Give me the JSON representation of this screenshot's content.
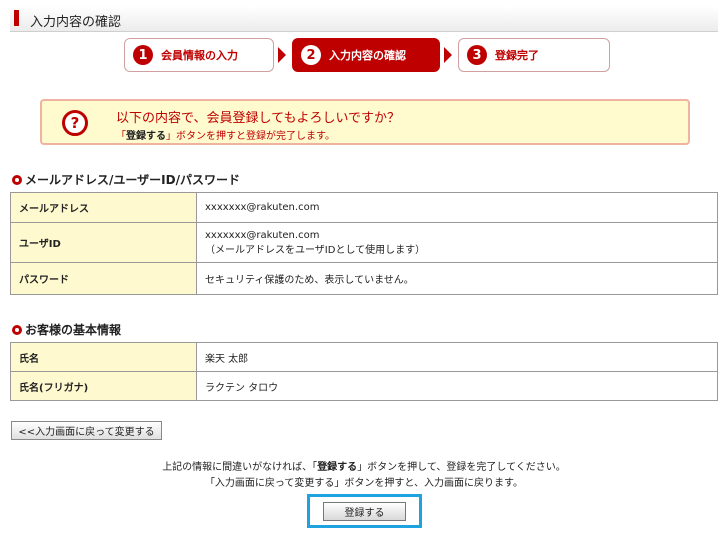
{
  "header": {
    "title": "入力内容の確認"
  },
  "steps": [
    {
      "num": "1",
      "label": "会員情報の入力"
    },
    {
      "num": "2",
      "label": "入力内容の確認"
    },
    {
      "num": "3",
      "label": "登録完了"
    }
  ],
  "confirm": {
    "icon": "?",
    "question": "以下の内容で、会員登録してもよろしいですか？",
    "note_pre": "「",
    "note_bold": "登録する",
    "note_post": "」ボタンを押すと登録が完了します。"
  },
  "account_section": {
    "title": "メールアドレス/ユーザーID/パスワード",
    "rows": [
      {
        "label": "メールアドレス",
        "value": "xxxxxxx@rakuten.com"
      },
      {
        "label": "ユーザID",
        "value": "xxxxxxx@rakuten.com",
        "value2": "（メールアドレスをユーザIDとして使用します）"
      },
      {
        "label": "パスワード",
        "value": "セキュリティ保護のため、表示していません。"
      }
    ]
  },
  "basic_section": {
    "title": "お客様の基本情報",
    "rows": [
      {
        "label": "氏名",
        "value": "楽天 太郎"
      },
      {
        "label": "氏名(フリガナ)",
        "value": "ラクテン タロウ"
      }
    ]
  },
  "back_button": "<<入力画面に戻って変更する",
  "notice": {
    "line1_pre": "上記の情報に間違いがなければ、「",
    "line1_bold": "登録する",
    "line1_post": "」ボタンを押して、登録を完了してください。",
    "line2": "「入力画面に戻って変更する」ボタンを押すと、入力画面に戻ります。"
  },
  "register_button": "登録する",
  "colors": {
    "accent": "#bf0000",
    "highlight": "#1fa3e0",
    "label_bg": "#fff9cf",
    "notice_bg": "#fffbcf"
  }
}
